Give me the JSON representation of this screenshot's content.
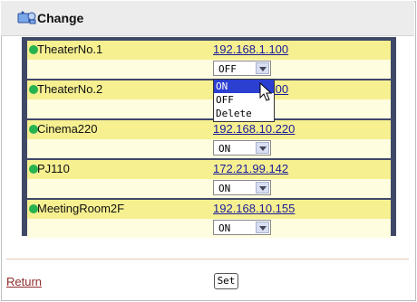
{
  "header": {
    "title": "Change",
    "icon": "camera-icon"
  },
  "devices": [
    {
      "name": "TheaterNo.1",
      "ip": "192.168.1.100",
      "state": "OFF"
    },
    {
      "name": "TheaterNo.2",
      "ip": "192.168.1.200",
      "state": "ON"
    },
    {
      "name": "Cinema220",
      "ip": "192.168.10.220",
      "state": "ON"
    },
    {
      "name": "PJ110",
      "ip": "172.21.99.142",
      "state": "ON"
    },
    {
      "name": "MeetingRoom2F",
      "ip": "192.168.10.155",
      "state": "ON"
    }
  ],
  "dropdown": {
    "options": [
      "ON",
      "OFF",
      "Delete"
    ],
    "highlighted": "ON"
  },
  "footer": {
    "return_label": "Return",
    "set_label": "Set"
  },
  "colors": {
    "panel_bg": "#404868",
    "name_row_bg": "#f6f091",
    "select_row_bg": "#fffde0",
    "status_dot": "#27b34f",
    "link": "#1c1c9a",
    "return_link": "#8f2c2c",
    "highlight": "#2b3fd1"
  }
}
